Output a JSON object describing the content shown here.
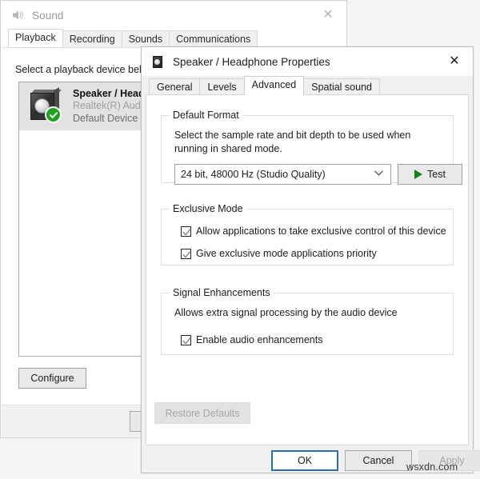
{
  "sound_window": {
    "title": "Sound",
    "title_icon": "speaker-icon",
    "close_icon": "✕",
    "tabs": [
      {
        "label": "Playback",
        "active": true
      },
      {
        "label": "Recording",
        "active": false
      },
      {
        "label": "Sounds",
        "active": false
      },
      {
        "label": "Communications",
        "active": false
      }
    ],
    "instruction": "Select a playback device bel",
    "device": {
      "name": "Speaker / Headp",
      "driver": "Realtek(R) Audio",
      "status": "Default Device",
      "badge_icon": "green-check-icon"
    },
    "configure_label": "Configure"
  },
  "properties_dialog": {
    "title": "Speaker / Headphone Properties",
    "title_icon": "speaker-icon",
    "close_icon": "✕",
    "tabs": [
      {
        "label": "General",
        "active": false
      },
      {
        "label": "Levels",
        "active": false
      },
      {
        "label": "Advanced",
        "active": true
      },
      {
        "label": "Spatial sound",
        "active": false
      }
    ],
    "default_format": {
      "legend": "Default Format",
      "description": "Select the sample rate and bit depth to be used when running in shared mode.",
      "selected_value": "24 bit, 48000 Hz (Studio Quality)",
      "dropdown_icon": "chevron-down-icon",
      "test_label": "Test",
      "test_icon": "play-icon"
    },
    "exclusive_mode": {
      "legend": "Exclusive Mode",
      "checkboxes": [
        {
          "label": "Allow applications to take exclusive control of this device",
          "checked": true
        },
        {
          "label": "Give exclusive mode applications priority",
          "checked": true
        }
      ]
    },
    "signal_enhancements": {
      "legend": "Signal Enhancements",
      "description": "Allows extra signal processing by the audio device",
      "checkboxes": [
        {
          "label": "Enable audio enhancements",
          "checked": true
        }
      ]
    },
    "restore_defaults_label": "Restore Defaults",
    "footer_buttons": [
      {
        "label": "OK",
        "state": "focused"
      },
      {
        "label": "Cancel",
        "state": "normal"
      },
      {
        "label": "Apply",
        "state": "disabled"
      }
    ]
  },
  "watermark": {
    "text": "wsxdn.com"
  },
  "colors": {
    "accent": "#2f6ea5",
    "check_green": "#20a020",
    "play_green": "#15801b",
    "disabled_text": "#a6a6a6",
    "inactive_title": "#9a9a9a"
  }
}
